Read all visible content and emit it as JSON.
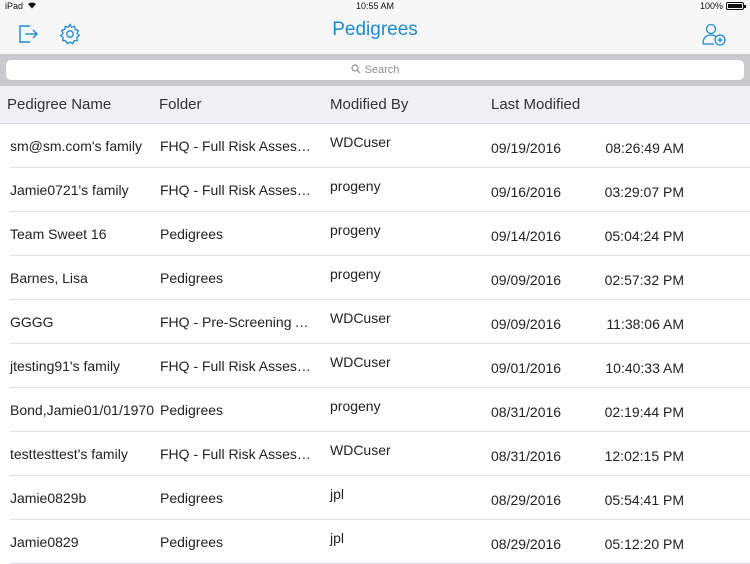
{
  "status_bar": {
    "device": "iPad",
    "time": "10:55 AM",
    "battery": "100%"
  },
  "nav": {
    "title": "Pedigrees",
    "icons": [
      "logout-icon",
      "gear-icon",
      "add-user-icon"
    ]
  },
  "search": {
    "placeholder": "Search"
  },
  "columns": {
    "name": "Pedigree Name",
    "folder": "Folder",
    "modified_by": "Modified By",
    "last_modified": "Last Modified"
  },
  "rows": [
    {
      "name": "sm@sm.com's family",
      "folder": "FHQ - Full Risk Assessment",
      "modified_by": "WDCuser",
      "date": "09/19/2016",
      "time": "08:26:49 AM"
    },
    {
      "name": "Jamie0721's family",
      "folder": "FHQ - Full Risk Assessment",
      "modified_by": "progeny",
      "date": "09/16/2016",
      "time": "03:29:07 PM"
    },
    {
      "name": "Team Sweet 16",
      "folder": "Pedigrees",
      "modified_by": "progeny",
      "date": "09/14/2016",
      "time": "05:04:24 PM"
    },
    {
      "name": "Barnes, Lisa",
      "folder": "Pedigrees",
      "modified_by": "progeny",
      "date": "09/09/2016",
      "time": "02:57:32 PM"
    },
    {
      "name": "GGGG",
      "folder": "FHQ - Pre-Screening Assessment",
      "modified_by": "WDCuser",
      "date": "09/09/2016",
      "time": "11:38:06 AM"
    },
    {
      "name": "jtesting91's family",
      "folder": "FHQ - Full Risk Assessment",
      "modified_by": "WDCuser",
      "date": "09/01/2016",
      "time": "10:40:33 AM"
    },
    {
      "name": "Bond,Jamie01/01/1970",
      "folder": "Pedigrees",
      "modified_by": "progeny",
      "date": "08/31/2016",
      "time": "02:19:44 PM"
    },
    {
      "name": "testtesttest's family",
      "folder": "FHQ - Full Risk Assessment",
      "modified_by": "WDCuser",
      "date": "08/31/2016",
      "time": "12:02:15 PM"
    },
    {
      "name": "Jamie0829b",
      "folder": "Pedigrees",
      "modified_by": "jpl",
      "date": "08/29/2016",
      "time": "05:54:41 PM"
    },
    {
      "name": "Jamie0829",
      "folder": "Pedigrees",
      "modified_by": "jpl",
      "date": "08/29/2016",
      "time": "05:12:20 PM"
    }
  ],
  "colors": {
    "accent": "#1a8ad4",
    "header_bg": "#efeff4",
    "search_bg": "#c9c9ce"
  }
}
